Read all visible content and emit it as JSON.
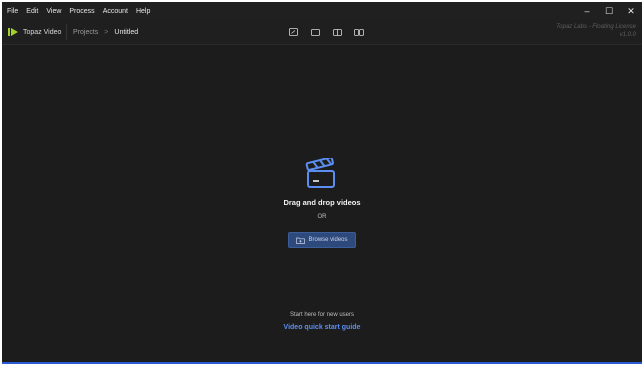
{
  "menu": {
    "items": [
      {
        "label": "File"
      },
      {
        "label": "Edit"
      },
      {
        "label": "View"
      },
      {
        "label": "Process"
      },
      {
        "label": "Account"
      },
      {
        "label": "Help"
      }
    ]
  },
  "window_controls": {
    "minimize": "–",
    "maximize": "☐",
    "close": "✕"
  },
  "toolbar": {
    "app_name": "Topaz Video",
    "breadcrumb": {
      "parent": "Projects",
      "separator": ">",
      "current": "Untitled"
    },
    "license": {
      "line1": "Topaz Labs - Floating License",
      "line2": "v1.0.0"
    },
    "view_modes": [
      "fullscreen-view-icon",
      "single-view-icon",
      "split-view-icon",
      "side-by-side-view-icon"
    ]
  },
  "drop_zone": {
    "title": "Drag and drop videos",
    "or": "OR",
    "browse_label": "Browse videos"
  },
  "footer": {
    "start_text": "Start here for new users",
    "guide_link": "Video quick start guide"
  },
  "colors": {
    "accent": "#5b8ef0",
    "brand": "#a3d12b",
    "button_bg": "#2e4a7d",
    "background": "#1c1c1c"
  }
}
